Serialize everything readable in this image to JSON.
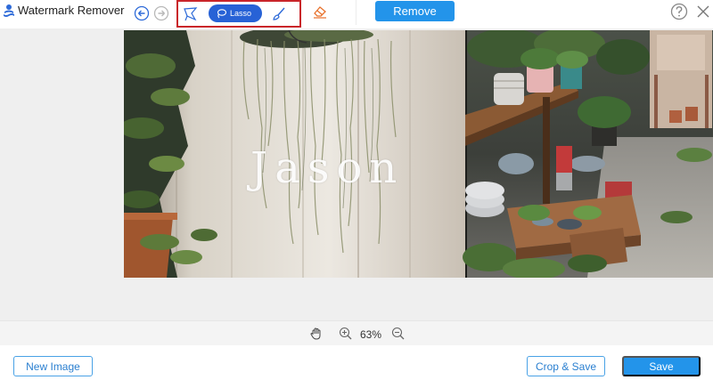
{
  "app": {
    "title": "Watermark Remover"
  },
  "toolbar": {
    "undo_icon": "undo-icon",
    "redo_icon": "redo-icon",
    "polygon_icon": "polygonal-lasso-icon",
    "lasso_label": "Lasso",
    "brush_icon": "brush-icon",
    "eraser_icon": "eraser-icon",
    "remove_label": "Remove",
    "help_icon": "help-icon",
    "close_icon": "close-icon"
  },
  "canvas": {
    "watermark_text": "Jason"
  },
  "zoom": {
    "hand_icon": "hand-icon",
    "zoom_in_icon": "zoom-in-icon",
    "level": "63%",
    "zoom_out_icon": "zoom-out-icon"
  },
  "footer": {
    "new_image_label": "New Image",
    "crop_save_label": "Crop & Save",
    "save_label": "Save"
  },
  "colors": {
    "accent": "#2394ea",
    "lasso_active": "#2762d6",
    "highlight_border": "#c9252a",
    "canvas_bg": "#efefef"
  }
}
